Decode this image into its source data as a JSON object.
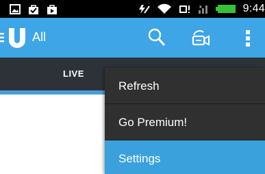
{
  "status_bar": {
    "time": "9:44",
    "left_icons": [
      "image-icon",
      "checkbox-bag-icon",
      "shopping-bag-icon"
    ],
    "right_icons": [
      "do-not-disturb-icon",
      "wifi-icon",
      "sync-icon",
      "signal-icon",
      "battery-icon"
    ],
    "battery_color": "#35c23a"
  },
  "action_bar": {
    "title": "All",
    "background": "#3ea5e7",
    "icons": [
      "menu-icon",
      "logo-u-icon",
      "search-icon",
      "broadcast-camera-icon",
      "more-vertical-icon"
    ]
  },
  "tabs": {
    "active_label": "LIVE",
    "indicator_color": "#4a9ed6"
  },
  "overflow_menu": {
    "items": [
      {
        "label": "Refresh",
        "selected": false
      },
      {
        "label": "Go Premium!",
        "selected": false
      },
      {
        "label": "Settings",
        "selected": true
      }
    ],
    "selected_color": "#3aa1dd"
  }
}
